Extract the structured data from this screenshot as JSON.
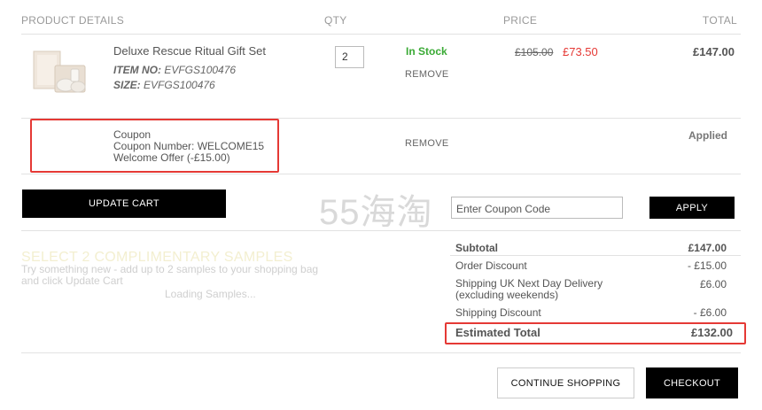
{
  "headers": {
    "product": "PRODUCT DETAILS",
    "qty": "QTY",
    "price": "PRICE",
    "total": "TOTAL"
  },
  "item": {
    "name": "Deluxe Rescue Ritual Gift Set",
    "item_no_label": "ITEM NO:",
    "item_no": "EVFGS100476",
    "size_label": "SIZE:",
    "size": "EVFGS100476",
    "qty": "2",
    "stock": "In Stock",
    "remove": "REMOVE",
    "old_price": "£105.00",
    "price": "£73.50",
    "total": "£147.00"
  },
  "coupon": {
    "title": "Coupon",
    "number": "Coupon Number: WELCOME15",
    "offer": "Welcome Offer (-£15.00)",
    "remove": "REMOVE",
    "status": "Applied"
  },
  "actions": {
    "update_cart": "UPDATE CART",
    "coupon_placeholder": "Enter Coupon Code",
    "apply": "APPLY",
    "continue": "CONTINUE SHOPPING",
    "checkout": "CHECKOUT"
  },
  "watermark": "55海淘",
  "samples": {
    "title": "SELECT 2 COMPLIMENTARY SAMPLES",
    "desc": "Try something new - add up to 2 samples to your shopping bag and click Update Cart",
    "loading": "Loading Samples..."
  },
  "summary": {
    "subtotal_label": "Subtotal",
    "subtotal": "£147.00",
    "order_discount_label": "Order Discount",
    "order_discount": "- £15.00",
    "shipping_label": "Shipping UK Next Day Delivery (excluding weekends)",
    "shipping": "£6.00",
    "shipping_discount_label": "Shipping Discount",
    "shipping_discount": "- £6.00",
    "estimated_total_label": "Estimated Total",
    "estimated_total": "£132.00"
  },
  "colors": {
    "in_stock": "#3aaa35",
    "sale_price": "#e53935",
    "highlight_box": "#e53935",
    "button": "#000000"
  }
}
